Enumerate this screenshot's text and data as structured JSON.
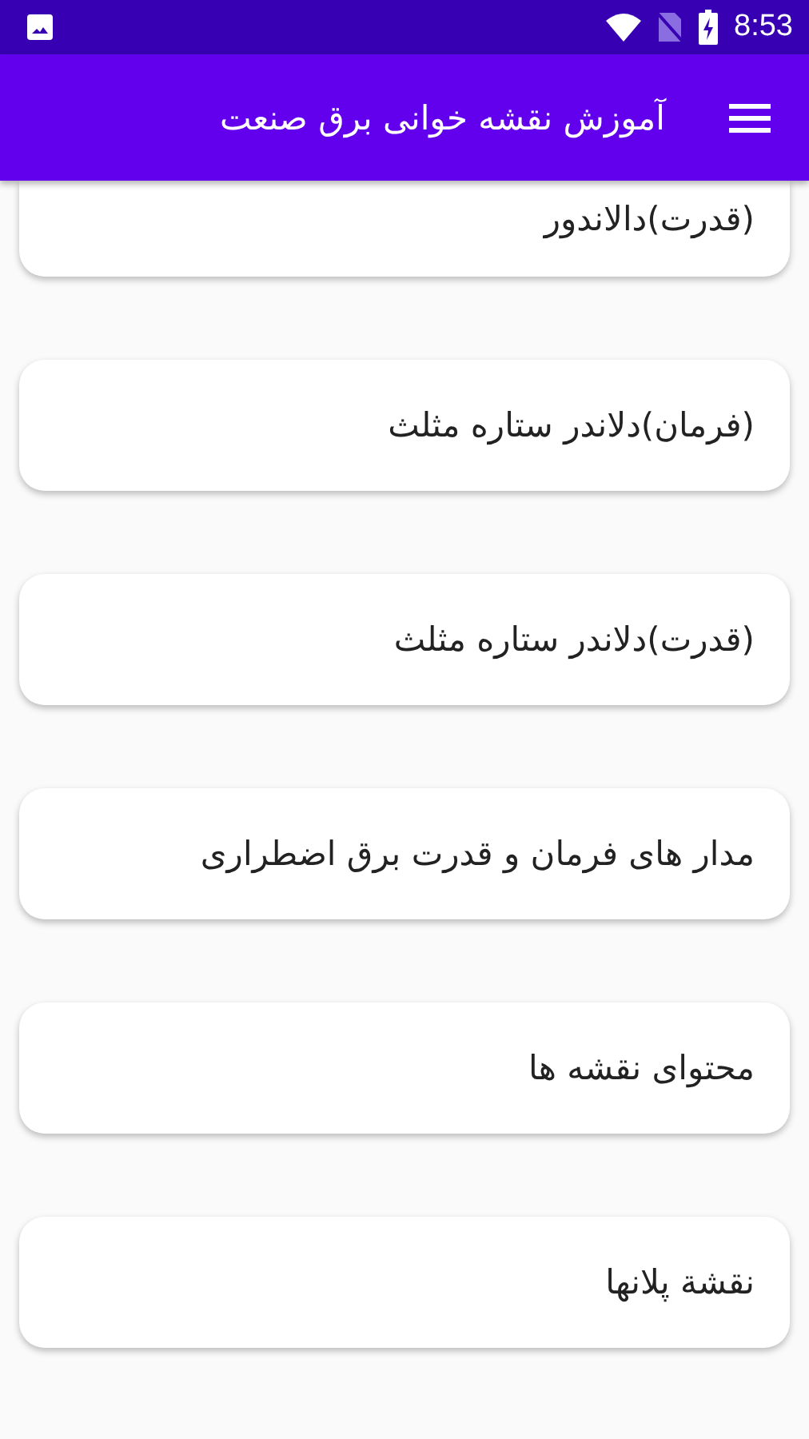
{
  "status_bar": {
    "time": "8:53"
  },
  "app_bar": {
    "title": "آموزش نقشه خوانی برق صنعت"
  },
  "items": [
    {
      "label": "(قدرت)دالاندور"
    },
    {
      "label": "(فرمان)دلاندر ستاره مثلث"
    },
    {
      "label": "(قدرت)دلاندر ستاره مثلث"
    },
    {
      "label": "مدار های فرمان و قدرت برق اضطراری"
    },
    {
      "label": "محتوای نقشه ها"
    },
    {
      "label": "نقشة پلانها"
    }
  ]
}
